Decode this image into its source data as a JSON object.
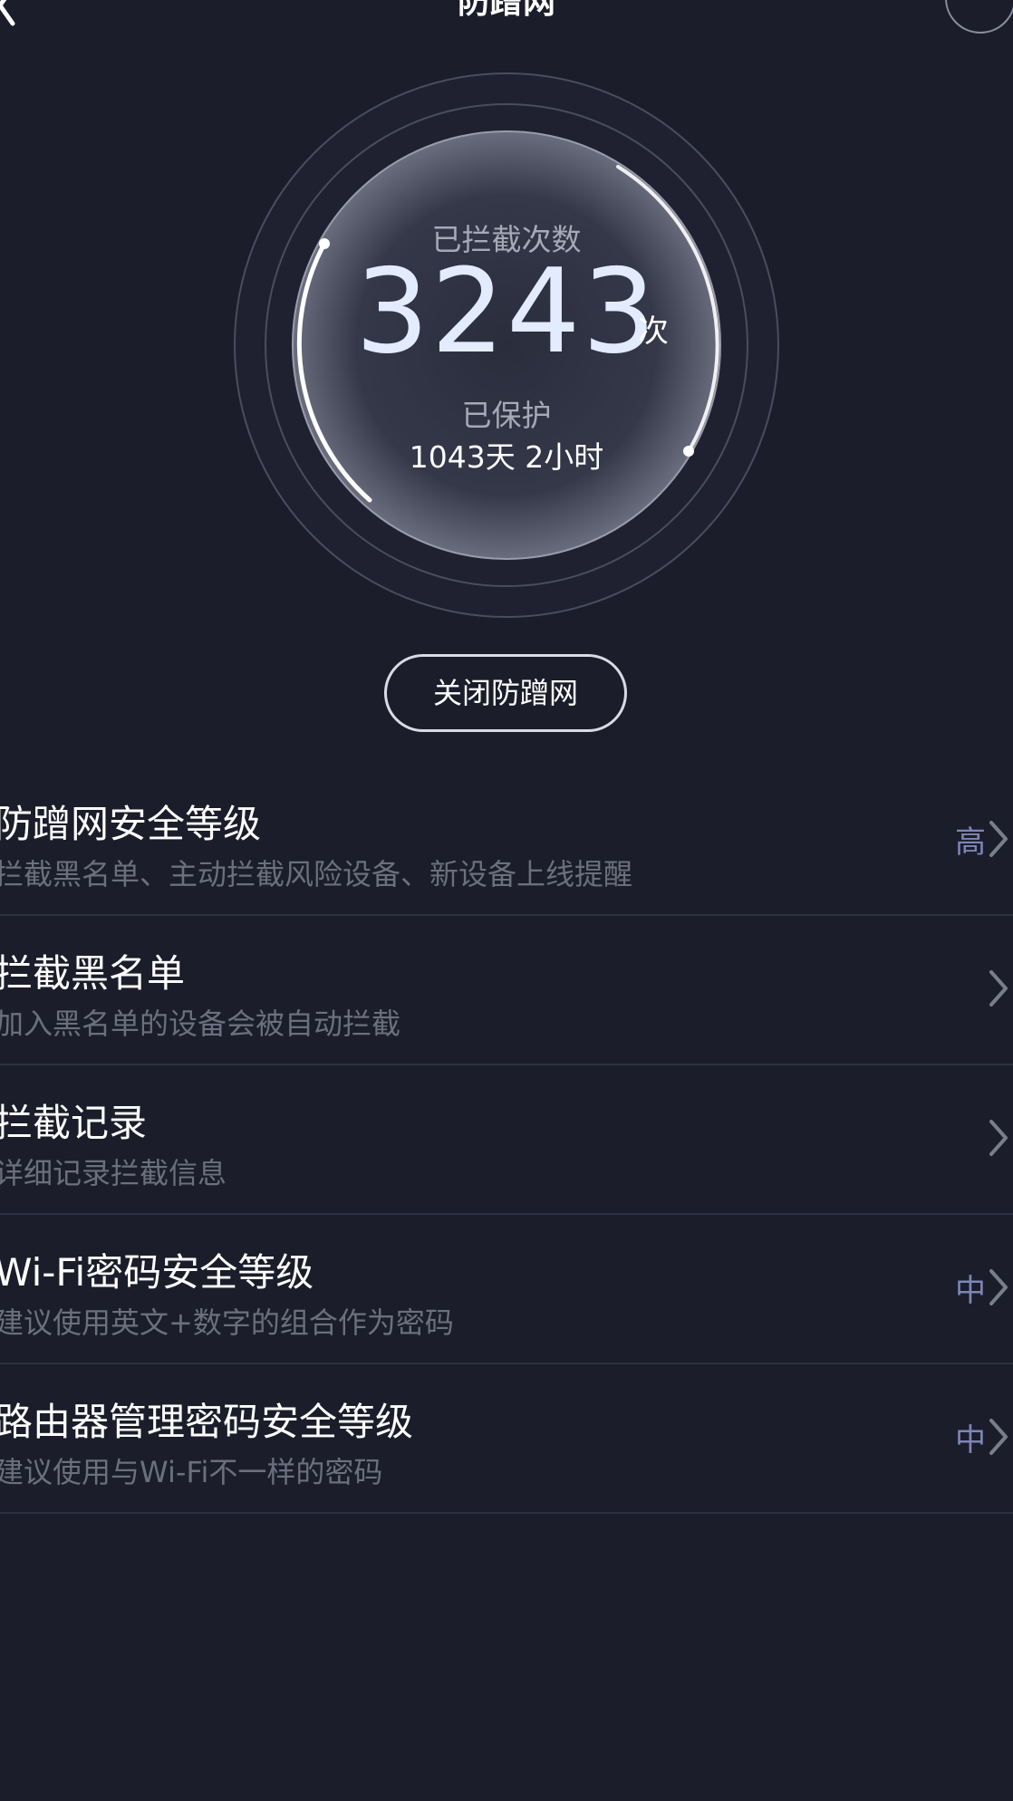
{
  "header": {
    "title": "防蹭网",
    "back_icon": "chevron-left-icon",
    "log_icon": "document-icon"
  },
  "dial": {
    "caption": "已拦截次数",
    "count": "3243",
    "unit": "次",
    "protected_label": "已保护",
    "protected_value": "1043天 2小时"
  },
  "action": {
    "close_label": "关闭防蹭网"
  },
  "list": {
    "items": [
      {
        "title": "防蹭网安全等级",
        "subtitle": "拦截黑名单、主动拦截风险设备、新设备上线提醒",
        "value": "高"
      },
      {
        "title": "拦截黑名单",
        "subtitle": "加入黑名单的设备会被自动拦截",
        "value": ""
      },
      {
        "title": "拦截记录",
        "subtitle": "详细记录拦截信息",
        "value": ""
      },
      {
        "title": "Wi-Fi密码安全等级",
        "subtitle": "建议使用英文+数字的组合作为密码",
        "value": "中"
      },
      {
        "title": "路由器管理密码安全等级",
        "subtitle": "建议使用与Wi-Fi不一样的密码",
        "value": "中"
      }
    ]
  },
  "colors": {
    "background": "#1b1d2a",
    "accent_value": "#7d86b8",
    "count_text": "#e3ecff"
  }
}
